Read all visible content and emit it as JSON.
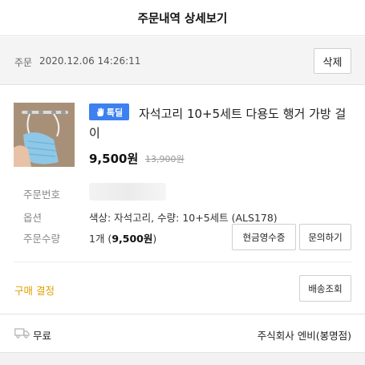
{
  "header": {
    "title": "주문내역 상세보기"
  },
  "order": {
    "date_label": "주문",
    "date": "2020.12.06 14:26:11",
    "delete_label": "삭제"
  },
  "product": {
    "thumbnail_icon": "product-thumbnail",
    "badge_label": "톡딜",
    "badge_color": "#3d80f0",
    "title": "자석고리 10+5세트 다용도 행거 가방 걸이",
    "price": "9,500원",
    "original_price": "13,900원"
  },
  "info": {
    "order_number_label": "주문번호",
    "option_label": "옵션",
    "option_value": "색상: 자석고리, 수량: 10+5세트 (ALS178)",
    "quantity_label": "주문수량",
    "quantity_prefix": "1개 (",
    "quantity_price": "9,500원",
    "quantity_suffix": ")",
    "receipt_button": "현금영수증",
    "inquiry_button": "문의하기"
  },
  "status": {
    "label": "구매 결정",
    "color": "#e0a100",
    "tracking_button": "배송조회"
  },
  "shipping": {
    "icon": "truck-icon",
    "fee": "무료",
    "seller": "주식회사 엔비(봉명점)"
  }
}
